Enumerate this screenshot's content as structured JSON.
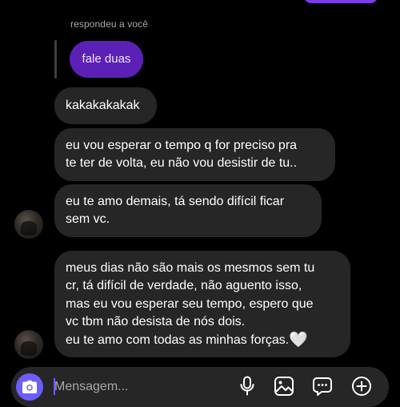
{
  "reply": {
    "label": "respondeu a você",
    "quoted_text": "fale duas"
  },
  "messages": [
    {
      "lines": [
        "kakakakakak"
      ]
    },
    {
      "lines": [
        "eu vou esperar o tempo q for preciso pra",
        "te ter de volta, eu não vou desistir de tu.."
      ]
    },
    {
      "lines": [
        "eu te amo demais, tá sendo difícil ficar",
        "sem vc."
      ]
    },
    {
      "lines": [
        "meus dias não são mais os mesmos sem tu",
        "cr, tá difícil de verdade, não aguento isso,",
        "mas eu vou esperar seu tempo, espero que",
        "vc tbm não desista de nós dois.",
        "eu te amo com todas as minhas forças."
      ],
      "emoji": "white-heart"
    }
  ],
  "composer": {
    "placeholder": "Mensagem...",
    "icons": [
      "camera-icon",
      "microphone-icon",
      "gallery-icon",
      "sticker-icon",
      "plus-icon"
    ]
  },
  "colors": {
    "background": "#000000",
    "received_bubble": "#262626",
    "sent_bubble": "#7c3aed",
    "replied_bubble": "#5b21b6",
    "accent": "#6d5dfc"
  }
}
